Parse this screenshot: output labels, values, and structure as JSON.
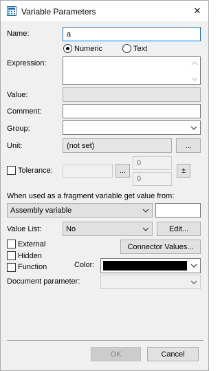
{
  "window": {
    "title": "Variable Parameters",
    "close_glyph": "✕",
    "icon": "calculator-icon"
  },
  "name": {
    "label": "Name:",
    "value": "a"
  },
  "type": {
    "numeric_label": "Numeric",
    "text_label": "Text",
    "selected": "Numeric"
  },
  "expression": {
    "label": "Expression:",
    "value": ""
  },
  "value_row": {
    "label": "Value:",
    "value": ""
  },
  "comment": {
    "label": "Comment:",
    "value": ""
  },
  "group": {
    "label": "Group:",
    "value": ""
  },
  "unit": {
    "label": "Unit:",
    "value": "(not set)",
    "browse_label": "..."
  },
  "tolerance": {
    "label": "Tolerance:",
    "checked": false,
    "value": "",
    "browse_label": "...",
    "upper": "0",
    "lower": "0",
    "plusminus_label": "±"
  },
  "fragment": {
    "label": "When used as a fragment variable get value from:",
    "source": "Assembly variable",
    "value": ""
  },
  "value_list": {
    "label": "Value List:",
    "value": "No",
    "edit_label": "Edit..."
  },
  "flags": {
    "external": {
      "label": "External",
      "checked": false
    },
    "hidden": {
      "label": "Hidden",
      "checked": false
    },
    "function": {
      "label": "Function",
      "checked": false
    }
  },
  "connector_values_label": "Connector Values...",
  "color": {
    "label": "Color:",
    "value": "#000000"
  },
  "document_parameter": {
    "label": "Document parameter:",
    "value": ""
  },
  "buttons": {
    "ok_label": "OK",
    "ok_enabled": false,
    "cancel_label": "Cancel"
  }
}
